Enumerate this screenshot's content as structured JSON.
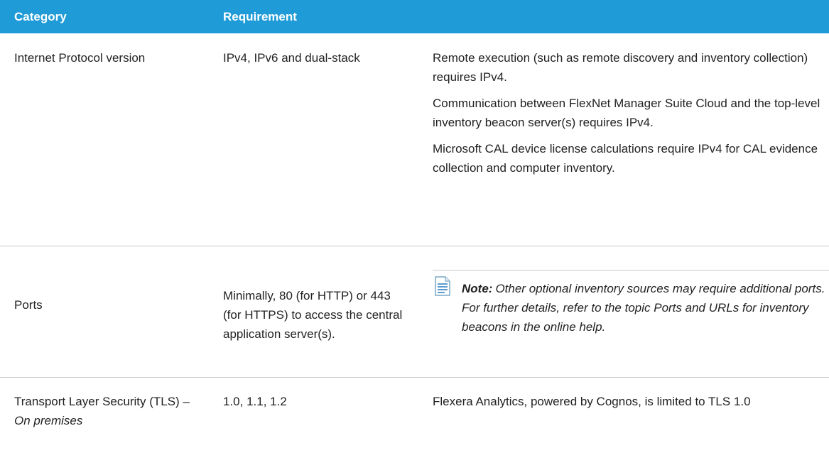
{
  "header": {
    "category": "Category",
    "requirement": "Requirement"
  },
  "rows": [
    {
      "category": "Internet Protocol version",
      "requirement": "IPv4, IPv6 and dual-stack",
      "notes": [
        "Remote execution (such as remote discovery and inventory collection) requires IPv4.",
        "Communication between FlexNet Manager Suite Cloud and the top-level inventory beacon server(s) requires IPv4.",
        "Microsoft CAL device license calculations require IPv4 for CAL evidence collection and computer inventory."
      ]
    },
    {
      "category": "Ports",
      "requirement": "Minimally, 80 (for HTTP) or 443 (for HTTPS) to access the central application server(s).",
      "note_label": "Note:",
      "note_text": "Other optional inventory sources may require additional ports. For further details, refer to the topic Ports and URLs for inventory beacons in the online help."
    },
    {
      "category": "Transport Layer Security (TLS) –",
      "category_italic": "On premises",
      "requirement": "1.0, 1.1, 1.2",
      "notes": [
        "Flexera Analytics, powered by Cognos, is limited to TLS 1.0"
      ]
    }
  ],
  "colors": {
    "header_bg": "#1f9bd7",
    "header_text": "#ffffff",
    "rule": "#c8c8c8"
  },
  "icons": {
    "note": "document-note-icon"
  }
}
